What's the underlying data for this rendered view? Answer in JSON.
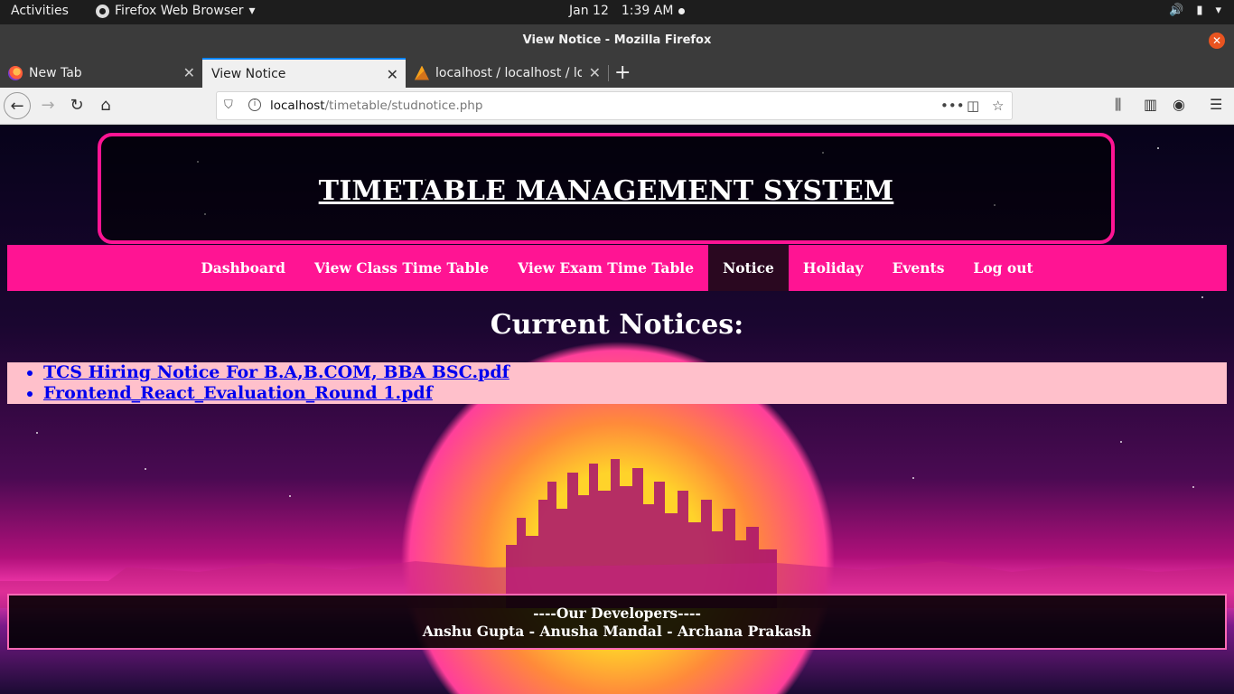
{
  "gnome": {
    "activities": "Activities",
    "app_menu": "Firefox Web Browser",
    "date": "Jan 12",
    "time": "1:39 AM"
  },
  "window": {
    "title": "View Notice - Mozilla Firefox"
  },
  "tabs": [
    {
      "label": "New Tab",
      "active": false
    },
    {
      "label": "View Notice",
      "active": true
    },
    {
      "label": "localhost / localhost / logi",
      "active": false
    }
  ],
  "urlbar": {
    "host": "localhost",
    "path": "/timetable/studnotice.php"
  },
  "page": {
    "site_title": "TIMETABLE MANAGEMENT SYSTEM",
    "menu": [
      {
        "label": "Dashboard",
        "active": false
      },
      {
        "label": "View Class Time Table",
        "active": false
      },
      {
        "label": "View Exam Time Table",
        "active": false
      },
      {
        "label": "Notice",
        "active": true
      },
      {
        "label": "Holiday",
        "active": false
      },
      {
        "label": "Events",
        "active": false
      },
      {
        "label": "Log out",
        "active": false
      }
    ],
    "notices_heading": "Current Notices:",
    "notices": [
      "TCS Hiring Notice For B.A,B.COM, BBA BSC.pdf",
      "Frontend_React_Evaluation_Round 1.pdf"
    ],
    "footer": {
      "line1": "----Our Developers----",
      "line2": "Anshu Gupta - Anusha Mandal - Archana Prakash"
    }
  },
  "colors": {
    "accent": "#ff1493",
    "notice_bg": "#ffc0cb",
    "link": "#0000ee"
  }
}
